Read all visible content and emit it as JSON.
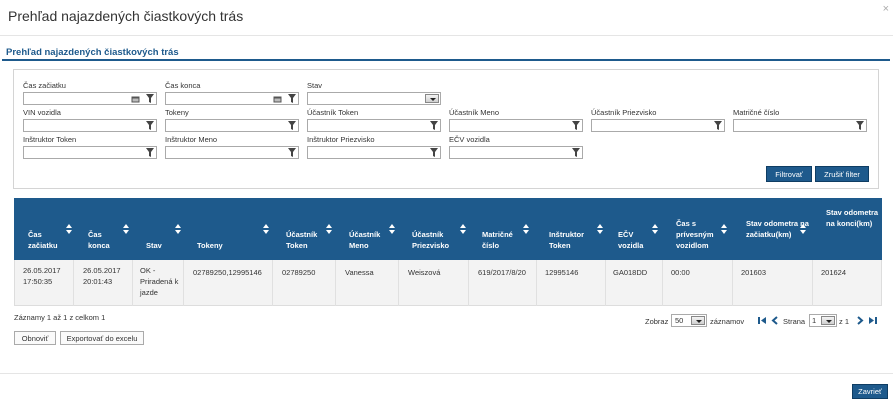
{
  "dialog": {
    "title": "Prehľad najazdených čiastkových trás",
    "close": "×",
    "section_title": "Prehľad najazdených čiastkových trás",
    "close_button": "Zavrieť"
  },
  "filters": {
    "cas_zaciatku": "Čas začiatku",
    "cas_konca": "Čas konca",
    "stav": "Stav",
    "vin_vozidla": "VIN vozidla",
    "tokeny": "Tokeny",
    "ucastnik_token": "Účastník Token",
    "ucastnik_meno": "Účastník Meno",
    "ucastnik_priezvisko": "Účastník Priezvisko",
    "maticne_cislo": "Matričné číslo",
    "instruktor_token": "Inštruktor Token",
    "instruktor_meno": "Inštruktor Meno",
    "instruktor_priezvisko": "Inštruktor Priezvisko",
    "ecv_vozidla": "EČV vozidla",
    "filter_button": "Filtrovať",
    "clear_button": "Zrušiť filter"
  },
  "grid": {
    "headers": [
      "Čas začiatku",
      "Čas konca",
      "Stav",
      "Tokeny",
      "Účastník Token",
      "Účastník Meno",
      "Účastník Priezvisko",
      "Matričné číslo",
      "Inštruktor Token",
      "EČV vozidla",
      "Čas s prívesným vozidlom",
      "Stav odometra na začiatku(km)",
      "Stav odometra na konci(km)"
    ],
    "rows": [
      [
        "26.05.2017 17:50:35",
        "26.05.2017 20:01:43",
        "OK - Priradená k jazde",
        "02789250,12995146",
        "02789250",
        "Vanessa",
        "Weiszová",
        "619/2017/8/20",
        "12995146",
        "GA018DD",
        "00:00",
        "201603",
        "201624"
      ]
    ]
  },
  "footer": {
    "records_info": "Záznamy 1 až 1 z celkom 1",
    "refresh_button": "Obnoviť",
    "export_button": "Exportovať do excelu"
  },
  "pager": {
    "show_label": "Zobraz",
    "page_size": "50",
    "records_label": "záznamov",
    "page_label": "Strana",
    "page_value": "1",
    "of_label": "z 1"
  },
  "colors": {
    "accent": "#1e5a8c"
  }
}
